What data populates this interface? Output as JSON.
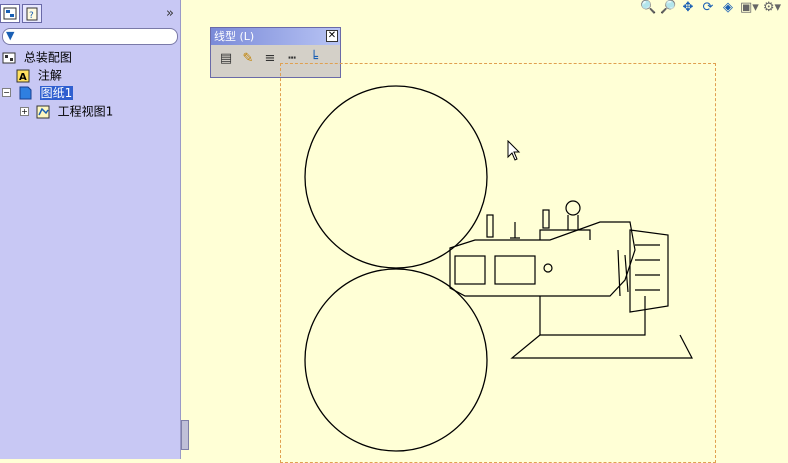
{
  "sidebar": {
    "filter_icon": "filter-icon",
    "tree": [
      {
        "label": "总装配图",
        "icon": "assembly-icon",
        "indent": 0
      },
      {
        "label": "注解",
        "icon": "annotation-icon",
        "indent": 1
      },
      {
        "label": "图纸1",
        "icon": "drawing-sheet-icon",
        "indent": 1,
        "selected": true
      },
      {
        "label": "工程视图1",
        "icon": "drawing-view-icon",
        "indent": 2
      }
    ]
  },
  "palette": {
    "title": "线型 (L)",
    "close": "✕",
    "icons": [
      "layer-properties-icon",
      "line-color-icon",
      "line-thickness-icon",
      "line-style-icon",
      "color-display-icon"
    ]
  },
  "toolbar": {
    "icons": [
      "zoom-to-fit-icon",
      "zoom-area-icon",
      "pan-icon",
      "rotate-icon",
      "view-orientation-icon",
      "display-style-icon",
      "view-settings-icon"
    ]
  },
  "colors": {
    "canvas": "#ffffd6",
    "sidebar": "#c8c8f4",
    "sheet_border": "#e0a050",
    "selection": "#2f5fd0"
  }
}
